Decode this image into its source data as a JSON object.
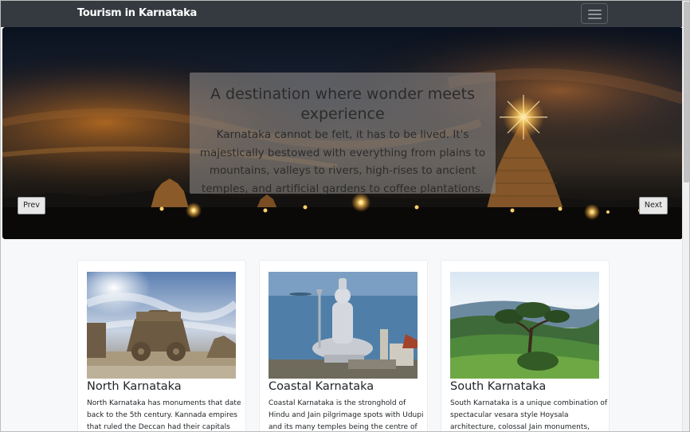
{
  "navbar": {
    "brand": "Tourism in Karnataka",
    "toggler_icon": "hamburger-icon"
  },
  "carousel": {
    "title": "A destination where wonder meets experience",
    "text": "Karnataka cannot be felt, it has to be lived. It's majestically bestowed with everything from plains to mountains, valleys to rivers, high-rises to ancient temples, and artificial gardens to coffee plantations.",
    "prev_label": "Prev",
    "next_label": "Next"
  },
  "cards": [
    {
      "title": "North Karnataka",
      "text": "North Karnataka has monuments that date back to the 5th century. Kannada empires that ruled the Deccan had their capitals"
    },
    {
      "title": "Coastal Karnataka",
      "text": "Coastal Karnataka is the stronghold of Hindu and Jain pilgrimage spots with Udupi and its many temples being the centre of"
    },
    {
      "title": "South Karnataka",
      "text": "South Karnataka is a unique combination of spectacular vesara style Hoysala architecture, colossal Jain monuments,"
    }
  ],
  "colors": {
    "navbar_bg": "#343a40",
    "page_bg": "#f7f8fa",
    "text": "#212529"
  }
}
